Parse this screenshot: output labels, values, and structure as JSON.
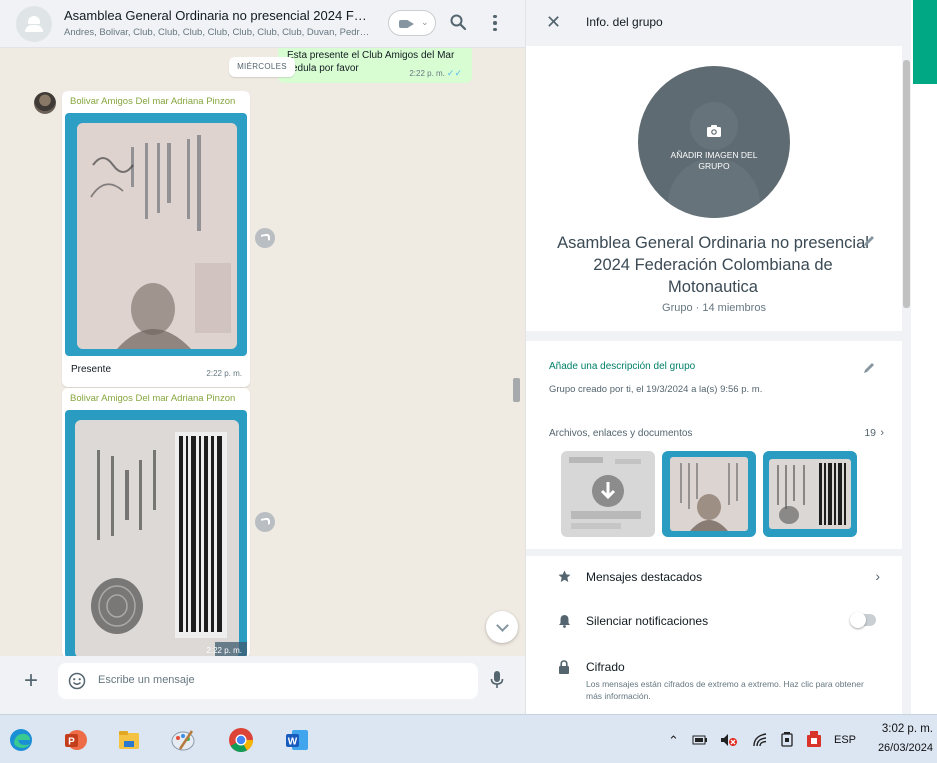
{
  "chat": {
    "title": "Asamblea General Ordinaria no presencial 2024 Feder...",
    "members": "Andres, Bolivar, Club, Club, Club, Club, Club, Club, Club, Duvan, Pedro, Re...",
    "outgoing_text": "Esta presente el Club Amigos del Mar cedula por favor",
    "outgoing_time": "2:22 p. m.",
    "date_chip": "MIÉRCOLES",
    "messages": [
      {
        "sender": "Bolivar Amigos Del mar Adriana Pinzon",
        "caption": "Presente",
        "time": "2:22 p. m."
      },
      {
        "sender": "Bolivar Amigos Del mar Adriana Pinzon",
        "caption": "",
        "time": "2:22 p. m."
      }
    ],
    "composer_placeholder": "Escribe un mensaje"
  },
  "info": {
    "header_title": "Info. del grupo",
    "add_photo_label": "AÑADIR IMAGEN DEL GRUPO",
    "group_name": "Asamblea General Ordinaria no presencial 2024 Federación Colombiana de Motonautica",
    "group_meta": "Grupo · 14 miembros",
    "add_description": "Añade una descripción del grupo",
    "created": "Grupo creado por ti, el 19/3/2024 a la(s) 9:56 p. m.",
    "files_label": "Archivos, enlaces y documentos",
    "files_count": "19",
    "options": [
      {
        "label": "Mensajes destacados",
        "icon": "star-icon"
      },
      {
        "label": "Silenciar notificaciones",
        "icon": "bell-icon"
      },
      {
        "label": "Cifrado",
        "icon": "lock-icon"
      }
    ],
    "encryption_desc": "Los mensajes están cifrados de extremo a extremo. Haz clic para obtener más información."
  },
  "taskbar": {
    "apps": [
      "edge-icon",
      "powerpoint-icon",
      "file-explorer-icon",
      "paint-icon",
      "chrome-icon",
      "word-icon"
    ],
    "language": "ESP",
    "time": "3:02 p. m.",
    "date": "26/03/2024"
  },
  "colors": {
    "accent_green": "#00a884",
    "outgoing_bubble": "#d9fdd3",
    "sender_name": "#86a63f"
  }
}
